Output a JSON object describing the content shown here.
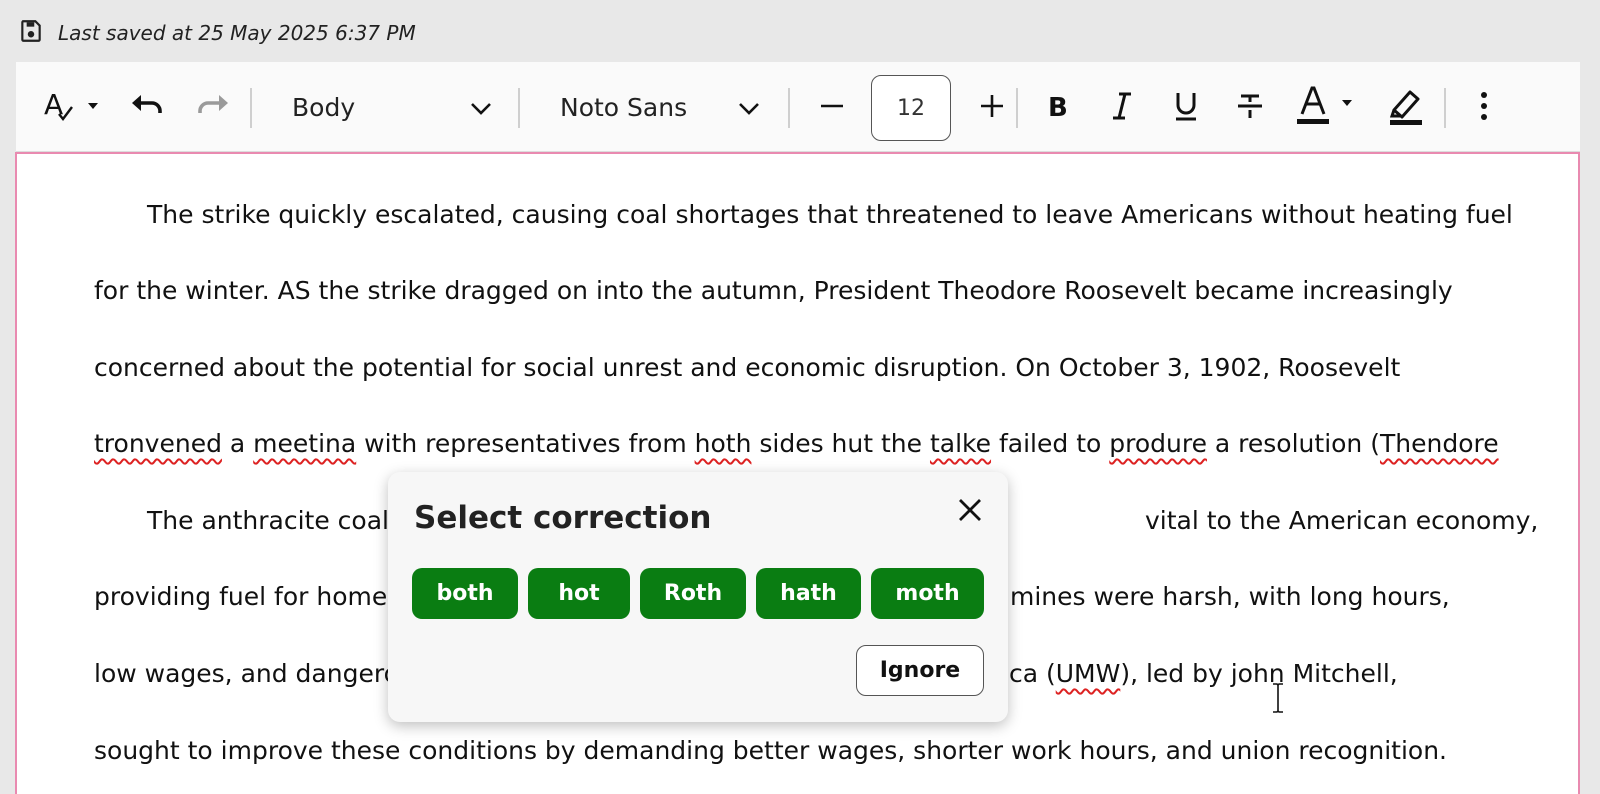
{
  "status": {
    "save_icon": "floppy-disk-icon",
    "text": "Last saved at 25 May 2025 6:37 PM"
  },
  "toolbar": {
    "spellcheck_icon": "spellcheck-icon",
    "undo_icon": "undo-icon",
    "redo_icon": "redo-icon",
    "paragraph_style": "Body",
    "font_family": "Noto Sans",
    "font_size": "12",
    "decrease_icon": "minus-icon",
    "increase_icon": "plus-icon",
    "bold_icon": "bold-icon",
    "italic_icon": "italic-icon",
    "underline_icon": "underline-icon",
    "strike_icon": "strikethrough-icon",
    "text_color_icon": "text-color-icon",
    "highlight_icon": "highlighter-icon",
    "more_icon": "more-vertical-icon"
  },
  "document": {
    "line1": "The strike quickly escalated, causing coal shortages that threatened to leave Americans without heating fuel",
    "line2": "for the winter. AS the strike dragged on into the autumn, President Theodore Roosevelt became increasingly",
    "line3": "concerned about the potential for social unrest and economic disruption. On October 3, 1902, Roosevelt",
    "line4": {
      "w1": "tronvened",
      "t1": " a ",
      "w2": "meetina",
      "t2": " with representatives from ",
      "w3": "hoth",
      "t3": " sides hut the ",
      "w4": "talke",
      "t4": " failed to ",
      "w5": "produre",
      "t5": " a resolution (",
      "w6": "Thendore"
    },
    "line5_left": "The anthracite coal i",
    "line5_right": "vital to the American economy,",
    "line6_left": "providing fuel for homes",
    "line6_right": "mines were harsh, with long hours,",
    "line7_left": "low wages, and dangero",
    "line7_right_a": "ica (",
    "line7_right_err": "UMW",
    "line7_right_b": "), led by john Mitchell,",
    "line8": "sought to improve these conditions by demanding better wages, shorter work hours, and union recognition."
  },
  "popup": {
    "title": "Select correction",
    "close_icon": "close-icon",
    "suggestions": [
      "both",
      "hot",
      "Roth",
      "hath",
      "moth"
    ],
    "ignore_label": "Ignore"
  },
  "colors": {
    "accent_green": "#0a7d12",
    "error_red": "#d22222",
    "focus_pink": "#e98ab0"
  }
}
